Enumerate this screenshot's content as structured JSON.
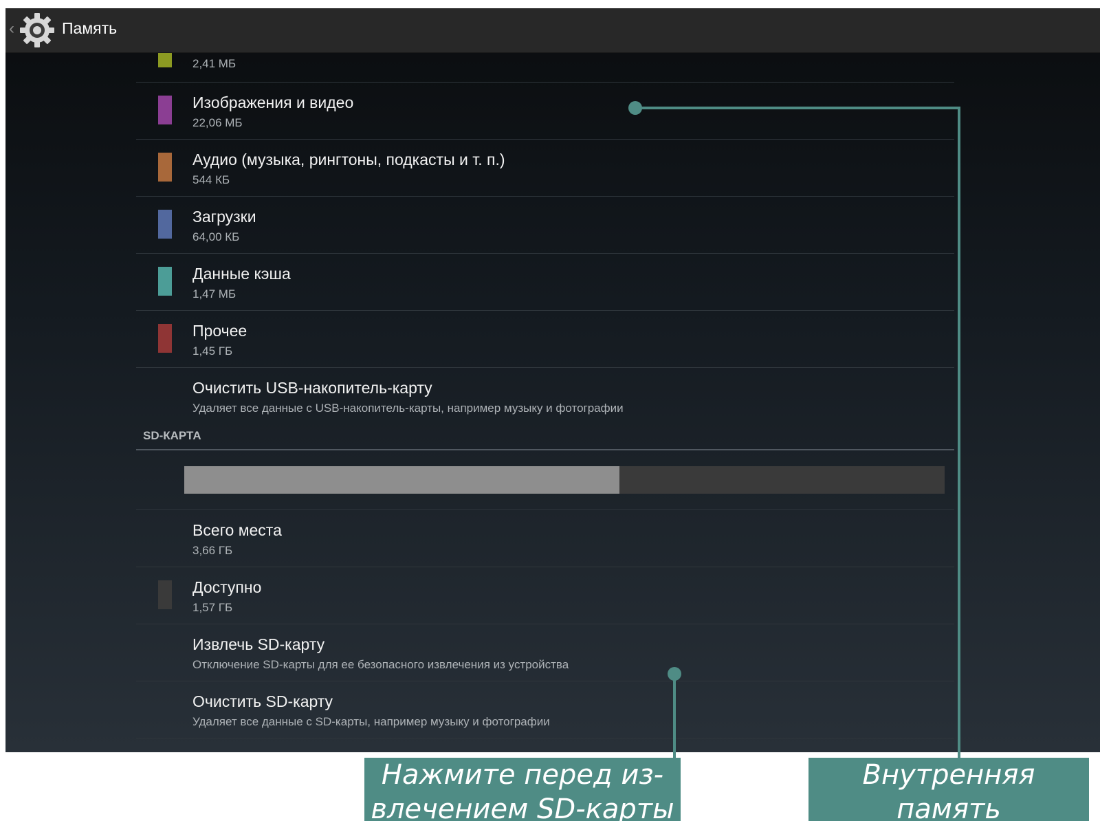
{
  "header": {
    "title": "Память",
    "back_icon": "chevron-left-icon",
    "app_icon": "gear-icon"
  },
  "internal_storage_items": [
    {
      "title": "",
      "size": "2,41 МБ",
      "color": "#8c9a22"
    },
    {
      "title": "Изображения и видео",
      "size": "22,06 МБ",
      "color": "#8b3e93"
    },
    {
      "title": "Аудио (музыка, рингтоны, подкасты и т. п.)",
      "size": "544 КБ",
      "color": "#a8683a"
    },
    {
      "title": "Загрузки",
      "size": "64,00 КБ",
      "color": "#52689e"
    },
    {
      "title": "Данные кэша",
      "size": "1,47 МБ",
      "color": "#4c9d97"
    },
    {
      "title": "Прочее",
      "size": "1,45 ГБ",
      "color": "#8f3535"
    }
  ],
  "clear_usb": {
    "title": "Очистить USB-накопитель-карту",
    "subtitle": "Удаляет все данные с USB-накопитель-карты, например музыку и фотографии"
  },
  "sd_section": {
    "header": "SD-КАРТА",
    "usage_fraction": 0.572,
    "used_color": "#8e8e8e",
    "free_color": "#3a3a3a",
    "total": {
      "title": "Всего места",
      "size": "3,66 ГБ"
    },
    "available": {
      "title": "Доступно",
      "size": "1,57 ГБ",
      "color": "#3a3a3a"
    },
    "unmount": {
      "title": "Извлечь SD-карту",
      "subtitle": "Отключение SD-карты для ее безопасного извлечения из устройства"
    },
    "erase": {
      "title": "Очистить SD-карту",
      "subtitle": "Удаляет все данные с SD-карты, например музыку и фотографии"
    }
  },
  "callouts": {
    "color": "#4f8c85",
    "unmount_note": {
      "line1": "Нажмите перед из-",
      "line2": "влечением SD-карты"
    },
    "internal_note": {
      "line1": "Внутренняя",
      "line2": "память"
    }
  }
}
